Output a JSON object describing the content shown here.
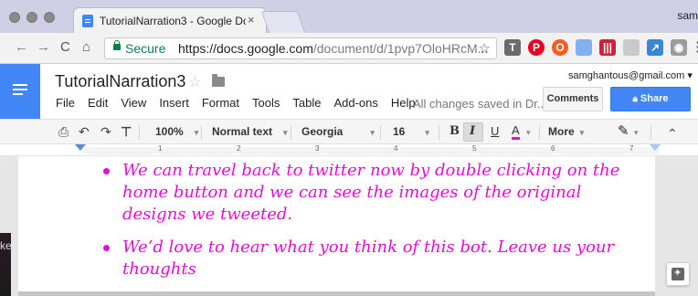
{
  "browser": {
    "tab_title": "TutorialNarration3 - Google Dc",
    "tab_close": "×",
    "profile_name": "sam",
    "nav_back": "←",
    "nav_forward": "→",
    "nav_reload": "C",
    "nav_home": "⌂",
    "secure_label": "Secure",
    "url_domain": "https://docs.google.com",
    "url_path": "/document/d/1pvp7OloHRcM...",
    "bookmark_star": "☆",
    "menu_dots": "⋮"
  },
  "docs": {
    "title": "TutorialNarration3",
    "menu": [
      "File",
      "Edit",
      "View",
      "Insert",
      "Format",
      "Tools",
      "Table",
      "Add-ons",
      "Help"
    ],
    "save_status": "All changes saved in Dr...",
    "account_email": "samghantous@gmail.com",
    "account_caret": "▾",
    "comments_label": "Comments",
    "share_label": "Share",
    "share_icon": "🔒"
  },
  "toolbar": {
    "print": "🖶",
    "undo": "↶",
    "redo": "↷",
    "paint_format": "🖌",
    "zoom": "100%",
    "style": "Normal text",
    "font": "Georgia",
    "font_size": "16",
    "bold": "B",
    "italic": "I",
    "underline": "U",
    "text_color": "A",
    "more": "More",
    "pen": "✎",
    "collapse": "⌃",
    "caret": "▾",
    "text_color_hex": "#e20fd2"
  },
  "ruler": {
    "numbers": [
      "1",
      "2",
      "3",
      "4",
      "5",
      "6",
      "7"
    ]
  },
  "document": {
    "bullets": [
      "We can travel back to twitter now by double clicking on the home button and we can see the images of the original designs we tweeted.",
      "We’d love to hear what you think of this bot. Leave us your thoughts"
    ],
    "text_color": "#e20fd2"
  },
  "side": {
    "left_edge_text": "ke"
  },
  "colors": {
    "docs_blue": "#4285f4",
    "secure_green": "#0b8043"
  }
}
